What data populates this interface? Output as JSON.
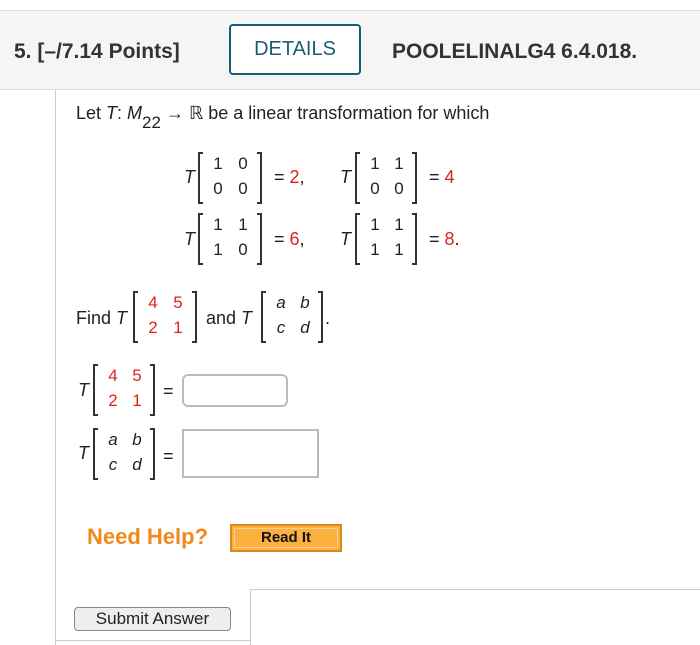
{
  "header": {
    "question_number": "5.",
    "points": "[–/7.14 Points]",
    "details_label": "DETAILS",
    "question_id": "POOLELINALG4 6.4.018."
  },
  "problem": {
    "intro_prefix": "Let ",
    "intro_T": "T",
    "intro_colon": ": ",
    "intro_M": "M",
    "intro_sub": "22",
    "intro_arrow": " → ℝ be a linear transformation for which",
    "given": [
      {
        "T": "T",
        "m": [
          "1",
          "0",
          "0",
          "0"
        ],
        "eq": "= ",
        "val": "2",
        "punct": ","
      },
      {
        "T": "T",
        "m": [
          "1",
          "1",
          "0",
          "0"
        ],
        "eq": "= ",
        "val": "4",
        "punct": ""
      },
      {
        "T": "T",
        "m": [
          "1",
          "1",
          "1",
          "0"
        ],
        "eq": "= ",
        "val": "6",
        "punct": ","
      },
      {
        "T": "T",
        "m": [
          "1",
          "1",
          "1",
          "1"
        ],
        "eq": "= ",
        "val": "8",
        "punct": "."
      }
    ],
    "find_label": "Find ",
    "find_T": "T",
    "find_m1": [
      "4",
      "5",
      "2",
      "1"
    ],
    "and_label": "and ",
    "find_T2": "T",
    "find_m2": [
      "a",
      "b",
      "c",
      "d"
    ],
    "find_end": "."
  },
  "answers": [
    {
      "T": "T",
      "m": [
        "4",
        "5",
        "2",
        "1"
      ],
      "eq": "=",
      "value": ""
    },
    {
      "T": "T",
      "m": [
        "a",
        "b",
        "c",
        "d"
      ],
      "eq": "=",
      "value": ""
    }
  ],
  "help": {
    "need_help": "Need Help?",
    "read_it": "Read It"
  },
  "submit_label": "Submit Answer"
}
